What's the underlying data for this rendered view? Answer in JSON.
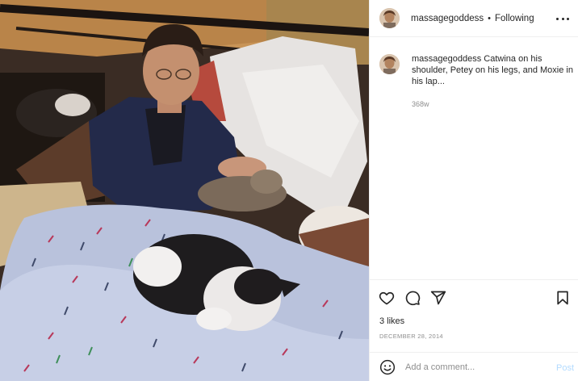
{
  "post": {
    "author": "massagegoddess",
    "separator": "•",
    "follow_status": "Following",
    "more_icon": "more-horizontal-icon",
    "photo_subject": "man with cats on a bed"
  },
  "caption": {
    "author": "massagegoddess",
    "text": "Catwina on his shoulder, Petey on his legs, and Moxie in his lap...",
    "time": "368w"
  },
  "actions": {
    "like_icon": "heart-icon",
    "comment_icon": "comment-icon",
    "share_icon": "send-icon",
    "save_icon": "bookmark-icon",
    "likes": "3 likes",
    "date": "DECEMBER 28, 2014"
  },
  "comment_box": {
    "emoji_icon": "emoji-icon",
    "placeholder": "Add a comment...",
    "post_label": "Post"
  },
  "colors": {
    "text": "#262626",
    "muted": "#8e8e8e",
    "border": "#efefef",
    "post_disabled": "#b3dbff"
  }
}
